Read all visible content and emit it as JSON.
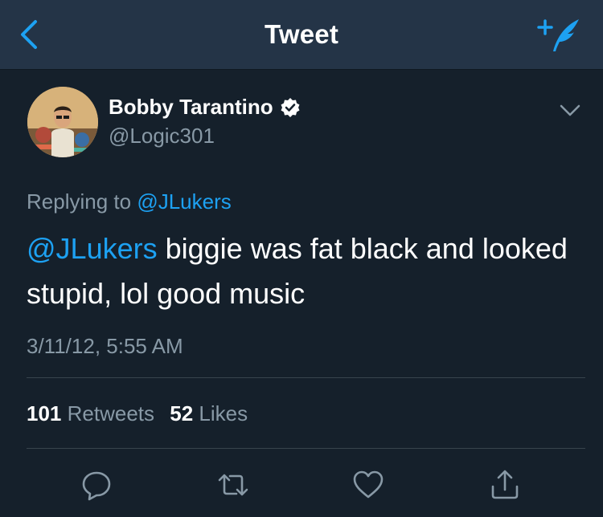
{
  "navbar": {
    "title": "Tweet",
    "back_icon": "chevron-left-icon",
    "compose_icon": "compose-tweet-icon",
    "accent_color": "#1da1f2"
  },
  "tweet": {
    "author": {
      "display_name": "Bobby Tarantino",
      "handle": "@Logic301",
      "verified": true
    },
    "reply": {
      "prefix": "Replying to ",
      "mention": "@JLukers"
    },
    "text": {
      "mention": "@JLukers",
      "body": " biggie was fat black and looked stupid, lol good music"
    },
    "timestamp": "3/11/12, 5:55 AM",
    "stats": {
      "retweets_count": "101",
      "retweets_label": "Retweets",
      "likes_count": "52",
      "likes_label": "Likes"
    },
    "actions": [
      "reply-icon",
      "retweet-icon",
      "like-icon",
      "share-icon"
    ]
  },
  "colors": {
    "background": "#15202b",
    "navbar": "#243447",
    "secondary_text": "#8899a6",
    "link": "#1da1f2",
    "divider": "#38444d"
  }
}
